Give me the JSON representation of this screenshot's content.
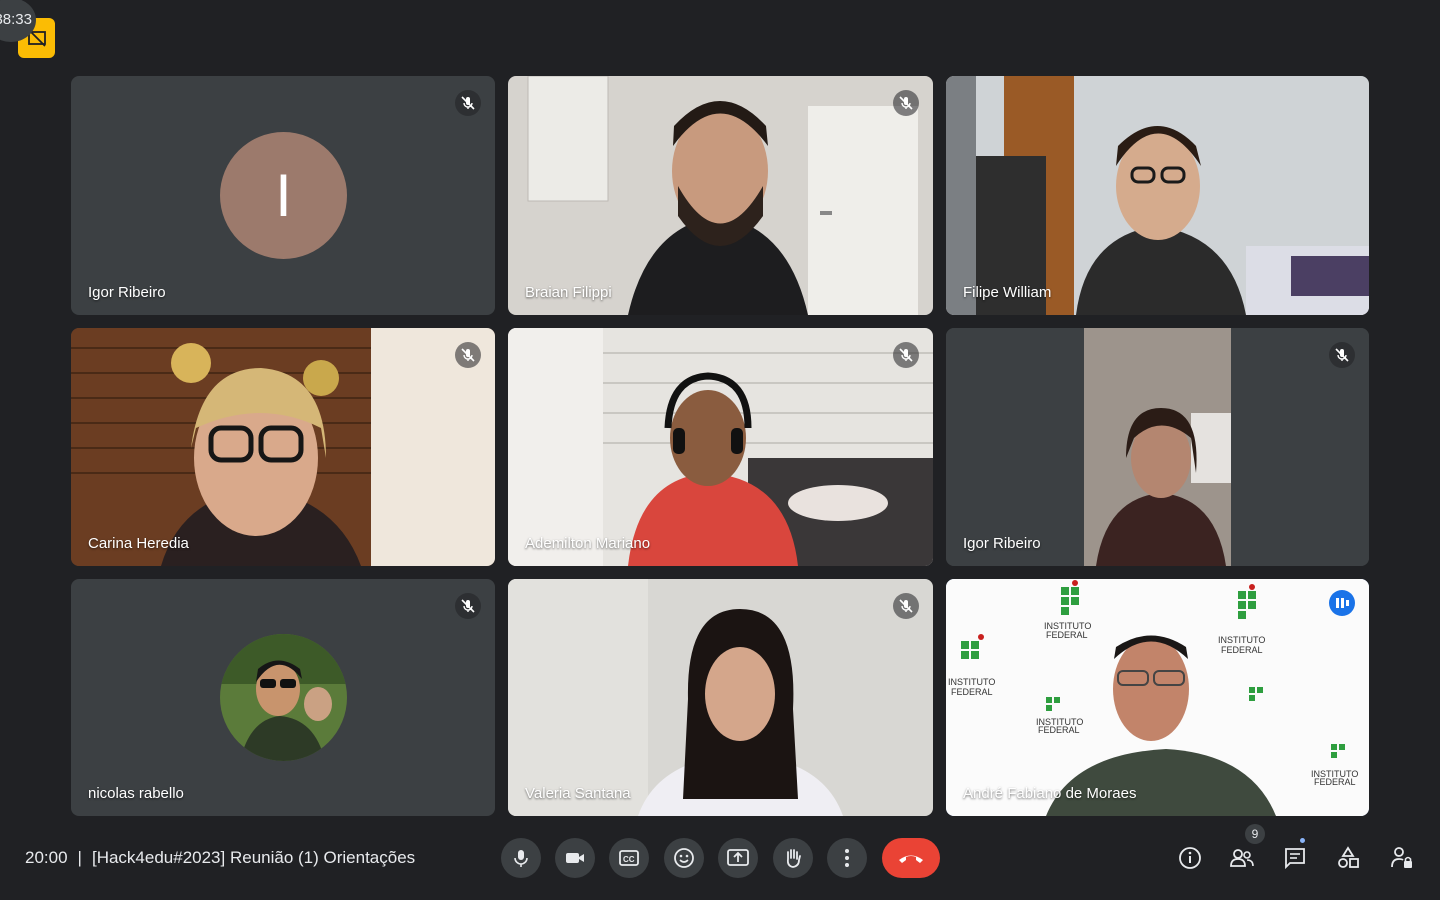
{
  "recording": {
    "elapsed": "38:33"
  },
  "participants": [
    {
      "name": "Igor Ribeiro",
      "initial": "I",
      "muted": true
    },
    {
      "name": "Braian Filippi",
      "muted": true
    },
    {
      "name": "Filipe William",
      "muted": false
    },
    {
      "name": "Carina Heredia",
      "muted": true
    },
    {
      "name": "Ademilton Mariano",
      "muted": true
    },
    {
      "name": "Igor Ribeiro",
      "muted": true
    },
    {
      "name": "nicolas rabello",
      "muted": true
    },
    {
      "name": "Valeria Santana",
      "muted": true
    },
    {
      "name": "André Fabiano de Moraes",
      "muted": false,
      "speaking": true
    }
  ],
  "meeting": {
    "time": "20:00",
    "separator": "|",
    "title": "[Hack4edu#2023] Reunião (1) Orientações"
  },
  "controls": [
    "mic-icon",
    "camera-icon",
    "captions-icon",
    "emoji-icon",
    "present-icon",
    "raise-hand-icon",
    "more-options-icon",
    "end-call-icon"
  ],
  "side_controls": {
    "people_count": "9"
  },
  "colors": {
    "accent": "#8ab4f8",
    "end_call": "#ea4335",
    "background": "#202124",
    "tile": "#3c4043"
  }
}
